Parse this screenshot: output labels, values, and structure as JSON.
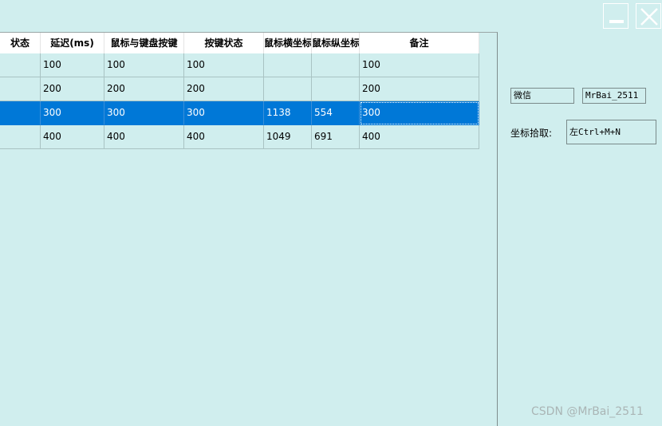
{
  "window": {
    "minimize_icon": "minimize-icon",
    "close_icon": "close-icon"
  },
  "grid": {
    "headers": [
      "状态",
      "延迟(ms)",
      "鼠标与键盘按键",
      "按键状态",
      "鼠标横坐标",
      "鼠标纵坐标",
      "备注"
    ],
    "rows": [
      {
        "status": "",
        "delay": "100",
        "key": "100",
        "key_state": "100",
        "mouse_x": "",
        "mouse_y": "",
        "note": "100"
      },
      {
        "status": "",
        "delay": "200",
        "key": "200",
        "key_state": "200",
        "mouse_x": "",
        "mouse_y": "",
        "note": "200"
      },
      {
        "status": "",
        "delay": "300",
        "key": "300",
        "key_state": "300",
        "mouse_x": "1138",
        "mouse_y": "554",
        "note": "300"
      },
      {
        "status": "",
        "delay": "400",
        "key": "400",
        "key_state": "400",
        "mouse_x": "1049",
        "mouse_y": "691",
        "note": "400"
      }
    ],
    "selected_row": 2,
    "selection_color": "#0078d7"
  },
  "panel": {
    "wechat_label": "微信",
    "wechat_id": "MrBai_2511",
    "pick_label": "坐标拾取:",
    "pick_hotkey": "左Ctrl+M+N"
  },
  "watermark": "CSDN @MrBai_2511",
  "colors": {
    "background": "#d0eeee",
    "header_bg": "#ffffff"
  }
}
